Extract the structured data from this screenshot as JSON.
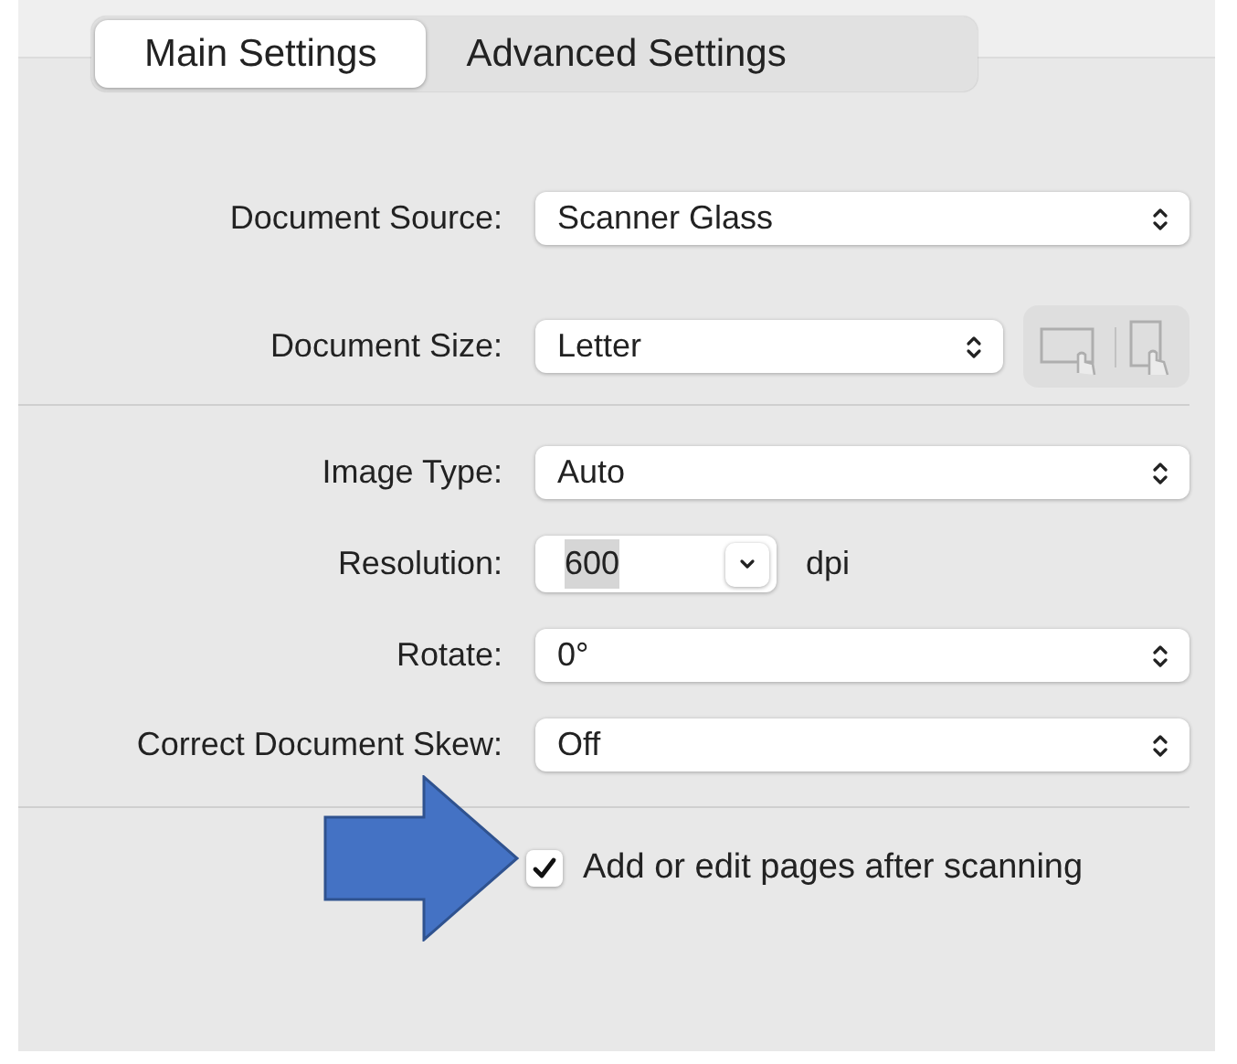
{
  "tabs": [
    {
      "label": "Main Settings",
      "selected": true
    },
    {
      "label": "Advanced Settings",
      "selected": false
    }
  ],
  "sections": [
    {
      "rows": [
        {
          "kind": "popup",
          "label": "Document Source:",
          "value": "Scanner Glass"
        },
        {
          "kind": "popup_orientation",
          "label": "Document Size:",
          "value": "Letter",
          "orientation_disabled": true
        }
      ]
    },
    {
      "rows": [
        {
          "kind": "popup",
          "label": "Image Type:",
          "value": "Auto"
        },
        {
          "kind": "combo",
          "label": "Resolution:",
          "value": "600",
          "value_selected": true,
          "unit": "dpi"
        },
        {
          "kind": "popup",
          "label": "Rotate:",
          "value": "0°"
        },
        {
          "kind": "popup",
          "label": "Correct Document Skew:",
          "value": "Off"
        }
      ]
    }
  ],
  "checkbox": {
    "label": "Add or edit pages after scanning",
    "checked": true
  }
}
